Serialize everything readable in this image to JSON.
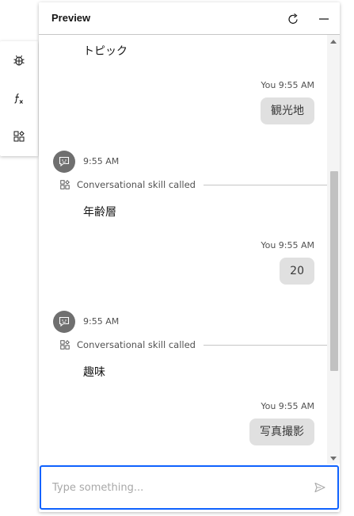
{
  "panel": {
    "title": "Preview"
  },
  "rail": {
    "items": [
      "bug-icon",
      "function-icon",
      "skill-icon"
    ]
  },
  "messages": [
    {
      "type": "bot_text",
      "text": "トピック"
    },
    {
      "type": "user",
      "time": "You 9:55 AM",
      "text": "観光地"
    },
    {
      "type": "bot",
      "time": "9:55 AM",
      "skill": "Conversational skill called",
      "text": "年齢層"
    },
    {
      "type": "user",
      "time": "You 9:55 AM",
      "text": "20"
    },
    {
      "type": "bot",
      "time": "9:55 AM",
      "skill": "Conversational skill called",
      "text": "趣味"
    },
    {
      "type": "user",
      "time": "You 9:55 AM",
      "text": "写真撮影"
    }
  ],
  "input": {
    "value": "",
    "placeholder": "Type something..."
  },
  "colors": {
    "accent": "#0f62fe",
    "bubble": "#e0e0e0",
    "avatar": "#6f6f6f"
  }
}
